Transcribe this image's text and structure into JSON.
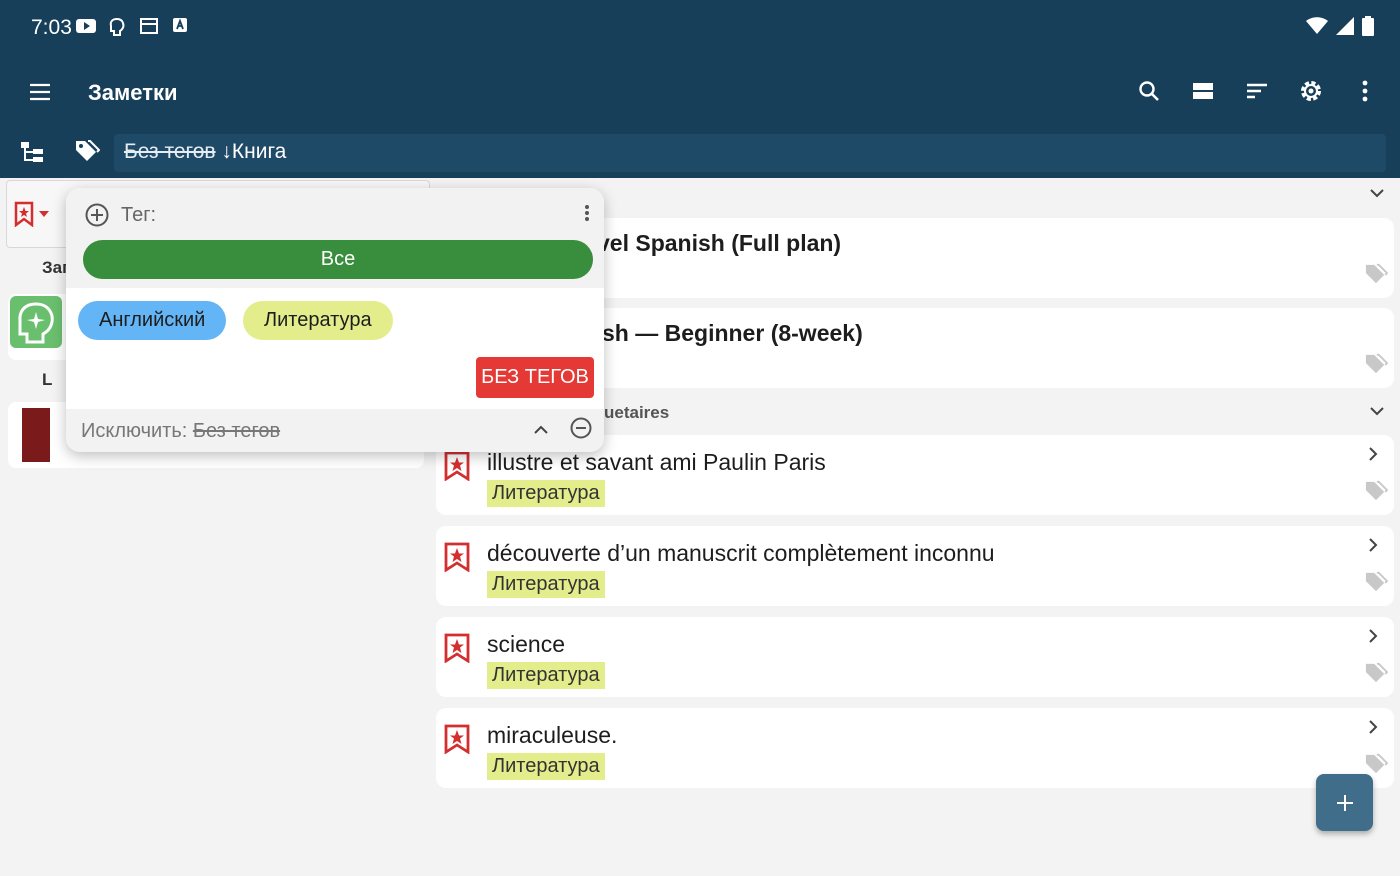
{
  "status_bar": {
    "time": "7:03"
  },
  "app_bar": {
    "title": "Заметки"
  },
  "filter": {
    "excluded_tag": "Без тегов",
    "sort_label": "↓Книга"
  },
  "left_pane": {
    "label_1": "Зап",
    "label_2": "L"
  },
  "list": {
    "cards": [
      {
        "title": "vel Spanish (Full plan)"
      },
      {
        "title": "sh — Beginner (8-week)"
      }
    ],
    "section_title": "uetaires",
    "notes": [
      {
        "title": "illustre et savant ami Paulin Paris",
        "tag": "Литература"
      },
      {
        "title": "découverte d’un manuscrit complètement inconnu",
        "tag": "Литература"
      },
      {
        "title": "science",
        "tag": "Литература"
      },
      {
        "title": "miraculeuse.",
        "tag": "Литература"
      }
    ]
  },
  "popup": {
    "tag_label": "Тег:",
    "all_label": "Все",
    "chips": [
      "Английский",
      "Литература"
    ],
    "no_tags_label": "БЕЗ ТЕГОВ",
    "exclude_label": "Исключить:",
    "exclude_value": "Без тегов"
  },
  "colors": {
    "app_bar": "#173f5a",
    "accent_green": "#388e3c",
    "tag_yellow": "#e3ed8c",
    "chip_blue": "#64b5f6",
    "danger_red": "#e53935"
  }
}
